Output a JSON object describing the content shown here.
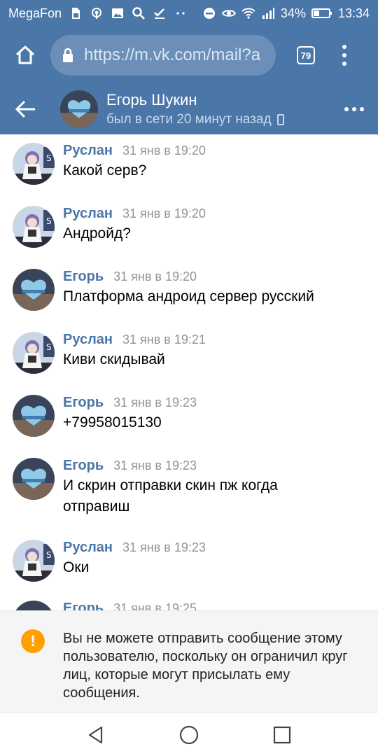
{
  "statusbar": {
    "carrier": "MegaFon",
    "battery": "34%",
    "time": "13:34",
    "icons": [
      "sim-card-icon",
      "wireless-icon",
      "image-icon",
      "search-icon",
      "checkmark-icon",
      "dots-icon",
      "do-not-disturb-icon",
      "eye-icon",
      "wifi-icon",
      "signal-icon",
      "battery-icon"
    ]
  },
  "browser": {
    "url": "https://m.vk.com/mail?a",
    "tabs_count": "79"
  },
  "chat": {
    "name": "Егорь Шукин",
    "status": "был в сети 20 минут назад"
  },
  "messages": [
    {
      "author": "Руслан",
      "time": "31 янв в 19:20",
      "text": "Какой серв?",
      "avatar": "ruslan"
    },
    {
      "author": "Руслан",
      "time": "31 янв в 19:20",
      "text": "Андройд?",
      "avatar": "ruslan"
    },
    {
      "author": "Егорь",
      "time": "31 янв в 19:20",
      "text": "Платформа андроид сервер русский",
      "avatar": "egor"
    },
    {
      "author": "Руслан",
      "time": "31 янв в 19:21",
      "text": "Киви скидывай",
      "avatar": "ruslan"
    },
    {
      "author": "Егорь",
      "time": "31 янв в 19:23",
      "text": "+79958015130",
      "avatar": "egor"
    },
    {
      "author": "Егорь",
      "time": "31 янв в 19:23",
      "text": "И скрин отправки скин пж когда отправиш",
      "avatar": "egor"
    },
    {
      "author": "Руслан",
      "time": "31 янв в 19:23",
      "text": "Оки",
      "avatar": "ruslan"
    },
    {
      "author": "Егорь",
      "time": "31 янв в 19:25",
      "text": "",
      "avatar": "egor"
    }
  ],
  "banner": {
    "text": "Вы не можете отправить сообщение этому пользователю, поскольку он ограничил круг лиц, которые могут присылать ему сообщения."
  },
  "colors": {
    "brand": "#4a76a8",
    "author": "#4a76a8",
    "warning": "#ffa000"
  }
}
